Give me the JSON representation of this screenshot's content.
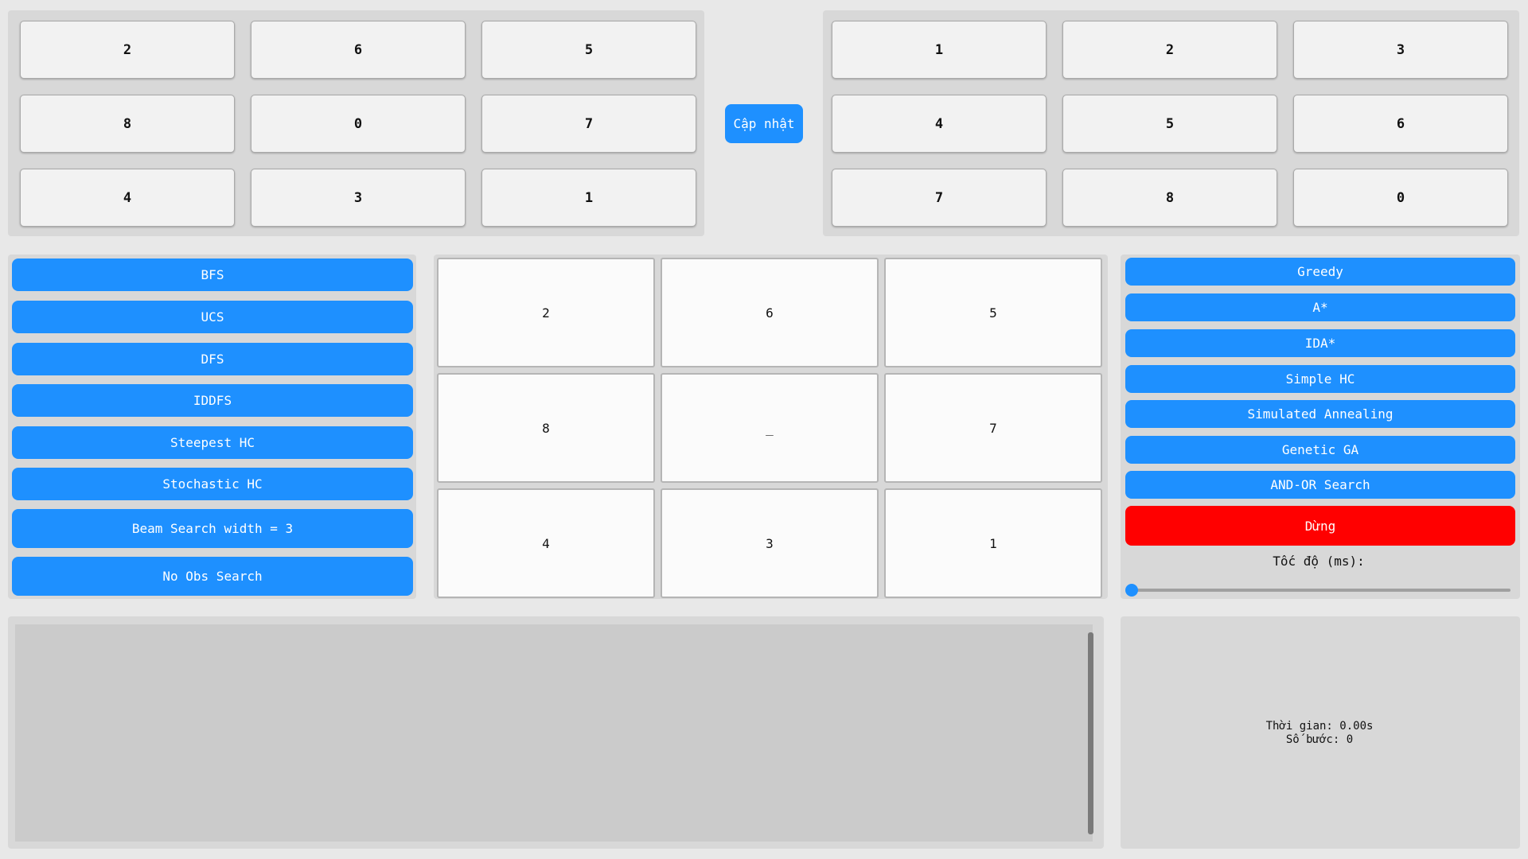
{
  "start_state": {
    "cells": [
      [
        "2",
        "6",
        "5"
      ],
      [
        "8",
        "0",
        "7"
      ],
      [
        "4",
        "3",
        "1"
      ]
    ]
  },
  "update_button": {
    "label": "Cập nhật"
  },
  "goal_state": {
    "cells": [
      [
        "1",
        "2",
        "3"
      ],
      [
        "4",
        "5",
        "6"
      ],
      [
        "7",
        "8",
        "0"
      ]
    ]
  },
  "left_algorithms": [
    {
      "id": "bfs",
      "label": "BFS"
    },
    {
      "id": "ucs",
      "label": "UCS"
    },
    {
      "id": "dfs",
      "label": "DFS"
    },
    {
      "id": "iddfs",
      "label": "IDDFS"
    },
    {
      "id": "steepest-hc",
      "label": "Steepest HC"
    },
    {
      "id": "stochastic-hc",
      "label": "Stochastic HC"
    },
    {
      "id": "beam-search",
      "label": "Beam Search width = 3"
    },
    {
      "id": "no-obs-search",
      "label": "No Obs Search"
    }
  ],
  "board": {
    "tiles": [
      [
        "2",
        "6",
        "5"
      ],
      [
        "8",
        "_",
        "7"
      ],
      [
        "4",
        "3",
        "1"
      ]
    ]
  },
  "right_algorithms": [
    {
      "id": "greedy",
      "label": "Greedy"
    },
    {
      "id": "a-star",
      "label": "A*"
    },
    {
      "id": "ida-star",
      "label": "IDA*"
    },
    {
      "id": "simple-hc",
      "label": "Simple HC"
    },
    {
      "id": "simulated-annealing",
      "label": "Simulated Annealing"
    },
    {
      "id": "genetic-ga",
      "label": "Genetic GA"
    },
    {
      "id": "and-or-search",
      "label": "AND-OR Search"
    }
  ],
  "stop_button": {
    "label": "Dừng"
  },
  "speed": {
    "label": "Tốc độ (ms):",
    "level": 0
  },
  "log": {
    "text": ""
  },
  "stats": {
    "time": "Thời gian: 0.00s",
    "steps": "Số bước: 0"
  },
  "colors": {
    "accent": "#1e90ff",
    "stop": "#ff0000"
  }
}
